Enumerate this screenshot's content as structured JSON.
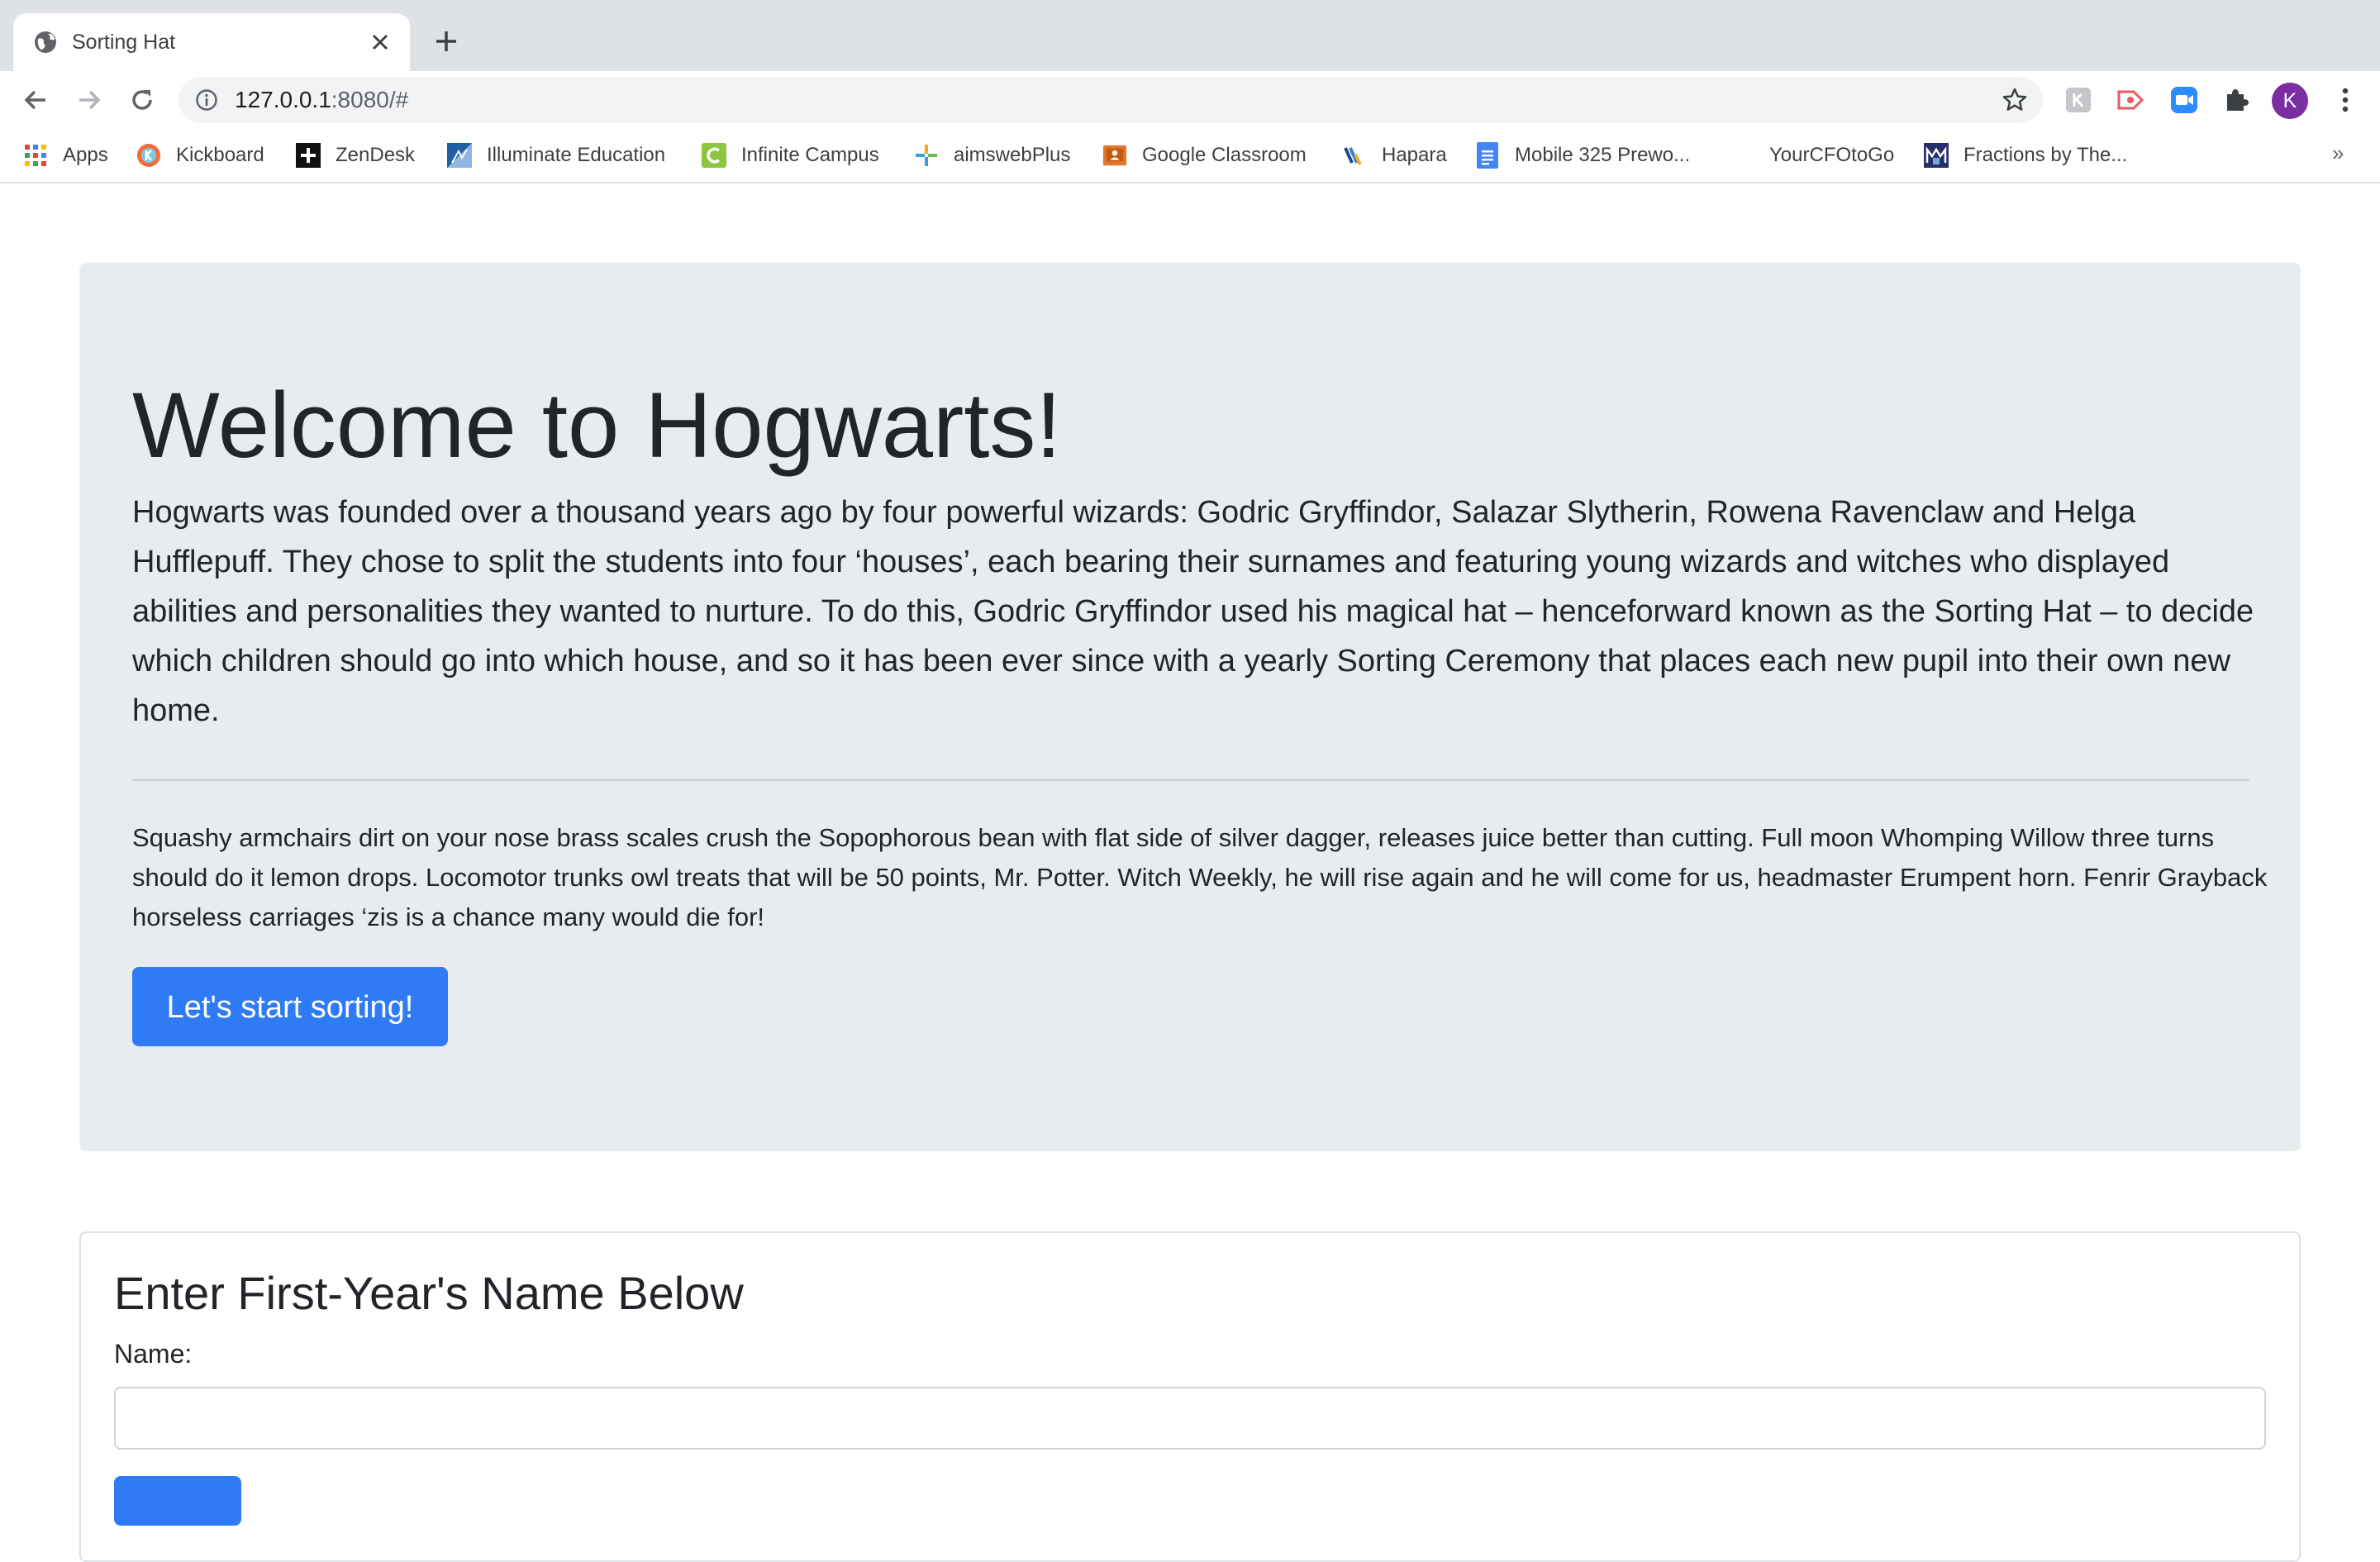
{
  "browser": {
    "tab_title": "Sorting Hat",
    "url_host": "127.0.0.1",
    "url_path": ":8080/#",
    "profile_initial": "K",
    "bookmarks": [
      {
        "label": "Apps",
        "icon": "apps-grid-icon"
      },
      {
        "label": "Kickboard",
        "icon": "kickboard-icon"
      },
      {
        "label": "ZenDesk",
        "icon": "zendesk-icon"
      },
      {
        "label": "Illuminate Education",
        "icon": "illuminate-icon"
      },
      {
        "label": "Infinite Campus",
        "icon": "infinite-campus-icon"
      },
      {
        "label": "aimswebPlus",
        "icon": "aimsweb-icon"
      },
      {
        "label": "Google Classroom",
        "icon": "google-classroom-icon"
      },
      {
        "label": "Hapara",
        "icon": "hapara-icon"
      },
      {
        "label": "Mobile 325 Prewo...",
        "icon": "google-docs-icon"
      },
      {
        "label": "YourCFOtoGo",
        "icon": ""
      },
      {
        "label": "Fractions by The...",
        "icon": "fractions-icon"
      }
    ],
    "bookmarks_overflow": "»"
  },
  "hero": {
    "title": "Welcome to Hogwarts!",
    "lead": "Hogwarts was founded over a thousand years ago by four powerful wizards: Godric Gryffindor, Salazar Slytherin, Rowena Ravenclaw and Helga Hufflepuff. They chose to split the students into four ‘houses’, each bearing their surnames and featuring young wizards and witches who displayed abilities and personalities they wanted to nurture. To do this, Godric Gryffindor used his magical hat – henceforward known as the Sorting Hat – to decide which children should go into which house, and so it has been ever since with a yearly Sorting Ceremony that places each new pupil into their own new home.",
    "body": "Squashy armchairs dirt on your nose brass scales crush the Sopophorous bean with flat side of silver dagger, releases juice better than cutting. Full moon Whomping Willow three turns should do it lemon drops. Locomotor trunks owl treats that will be 50 points, Mr. Potter. Witch Weekly, he will rise again and he will come for us, headmaster Erumpent horn. Fenrir Grayback horseless carriages ‘zis is a chance many would die for!",
    "button_label": "Let's start sorting!"
  },
  "form": {
    "title": "Enter First-Year's Name Below",
    "name_label": "Name:",
    "name_value": ""
  },
  "colors": {
    "primary": "#2f7bf5",
    "jumbotron_bg": "#e9ecef",
    "tabstrip_bg": "#dee1e6",
    "avatar_bg": "#7b2ea1"
  }
}
